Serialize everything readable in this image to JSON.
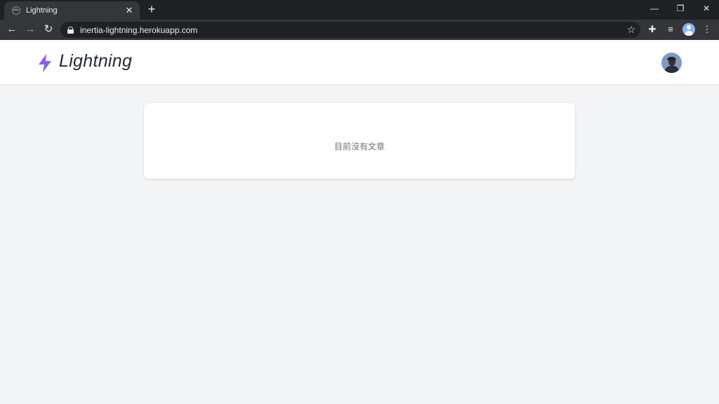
{
  "browser": {
    "tab_title": "Lightning",
    "tab_close": "✕",
    "new_tab": "+",
    "url": "inertia-lightning.herokuapp.com",
    "window_controls": {
      "minimize": "—",
      "restore": "❐",
      "close": "✕"
    }
  },
  "app": {
    "brand": "Lightning",
    "accent_color": "#8b5cf6",
    "empty_message": "目前沒有文章"
  },
  "icons": [
    "globe-icon",
    "lock-icon",
    "star-icon",
    "extensions-icon",
    "media-control-icon",
    "profile-icon",
    "menu-icon",
    "lightning-icon"
  ]
}
